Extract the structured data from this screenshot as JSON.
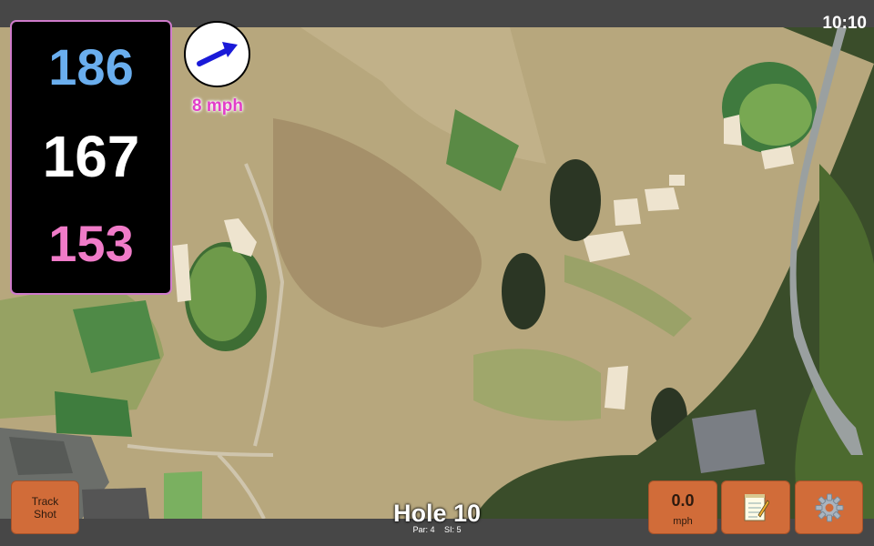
{
  "status": {
    "time": "10:10"
  },
  "distances": {
    "back": "186",
    "middle": "167",
    "front": "153",
    "back_color": "#6aaeee",
    "middle_color": "#ffffff",
    "front_color": "#f07bc8"
  },
  "wind": {
    "speed_label": "8 mph",
    "arrow_color": "#1a1ad8",
    "icon": "wind-direction-arrow"
  },
  "buttons": {
    "track_shot": "Track Shot",
    "wind_value": "0.0",
    "wind_unit": "mph",
    "notes_icon": "notepad-icon",
    "settings_icon": "gear-icon",
    "accent": "#d16c39"
  },
  "hole": {
    "title": "Hole 10",
    "par": "Par: 4",
    "si": "SI: 5"
  }
}
